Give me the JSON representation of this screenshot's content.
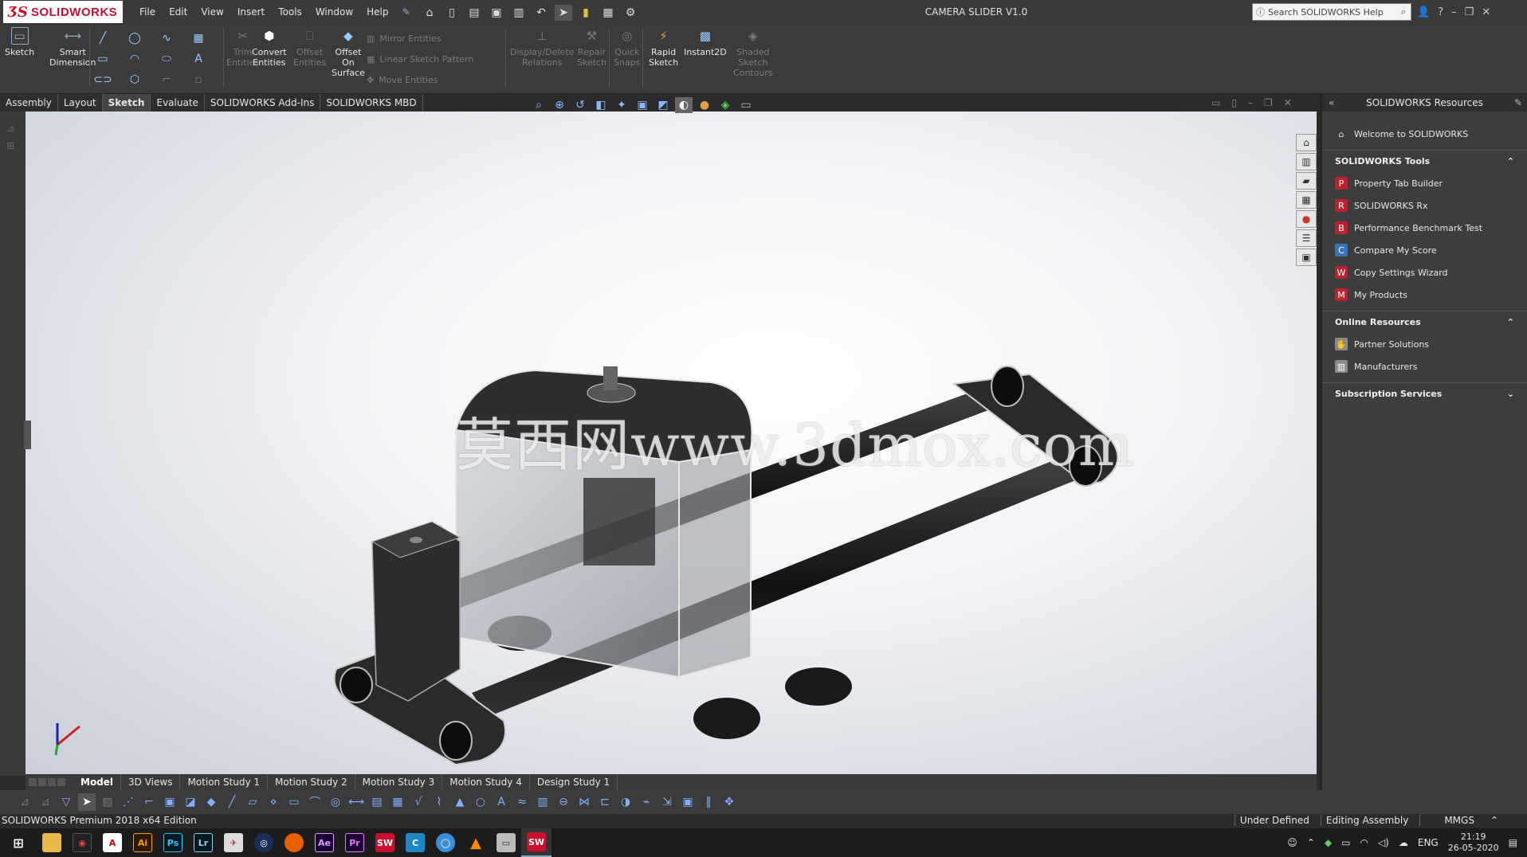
{
  "app": {
    "name": "SOLIDWORKS",
    "doc_title": "CAMERA SLIDER V1.0",
    "menu": [
      "File",
      "Edit",
      "View",
      "Insert",
      "Tools",
      "Window",
      "Help"
    ],
    "search_placeholder": "Search SOLIDWORKS Help"
  },
  "commands": {
    "sketch": "Sketch",
    "smart_dimension_1": "Smart",
    "smart_dimension_2": "Dimension",
    "trim_1": "Trim",
    "trim_2": "Entities",
    "convert_1": "Convert",
    "convert_2": "Entities",
    "offset_1": "Offset",
    "offset_2": "Entities",
    "offset_surface_1": "Offset",
    "offset_surface_2": "On",
    "offset_surface_3": "Surface",
    "mirror": "Mirror Entities",
    "linear_pattern": "Linear Sketch Pattern",
    "move": "Move Entities",
    "display_delete_1": "Display/Delete",
    "display_delete_2": "Relations",
    "repair_1": "Repair",
    "repair_2": "Sketch",
    "quick_snaps_1": "Quick",
    "quick_snaps_2": "Snaps",
    "rapid_1": "Rapid",
    "rapid_2": "Sketch",
    "instant2d": "Instant2D",
    "shaded_1": "Shaded",
    "shaded_2": "Sketch",
    "shaded_3": "Contours"
  },
  "cm_tabs": [
    "Assembly",
    "Layout",
    "Sketch",
    "Evaluate",
    "SOLIDWORKS Add-Ins",
    "SOLIDWORKS MBD"
  ],
  "cm_tabs_active": "Sketch",
  "watermark": "莫西网www.3dmox.com",
  "taskpane": {
    "title": "SOLIDWORKS Resources",
    "welcome": "Welcome to SOLIDWORKS",
    "tools_header": "SOLIDWORKS Tools",
    "tools": [
      "Property Tab Builder",
      "SOLIDWORKS Rx",
      "Performance Benchmark Test",
      "Compare My Score",
      "Copy Settings Wizard",
      "My Products"
    ],
    "online_header": "Online Resources",
    "online": [
      "Partner Solutions",
      "Manufacturers"
    ],
    "subscription_header": "Subscription Services"
  },
  "bottom_tabs": [
    "Model",
    "3D Views",
    "Motion Study 1",
    "Motion Study 2",
    "Motion Study 3",
    "Motion Study 4",
    "Design Study 1"
  ],
  "bottom_tabs_active": "Model",
  "status": {
    "left": "SOLIDWORKS Premium 2018 x64 Edition",
    "under_defined": "Under Defined",
    "editing": "Editing Assembly",
    "units": "MMGS"
  },
  "taskbar": {
    "lang": "ENG",
    "time": "21:19",
    "date": "26-05-2020"
  },
  "colors": {
    "brand": "#c8102e",
    "ui_dark": "#3b3b3b",
    "viewport_bg": "#e9ebef"
  }
}
